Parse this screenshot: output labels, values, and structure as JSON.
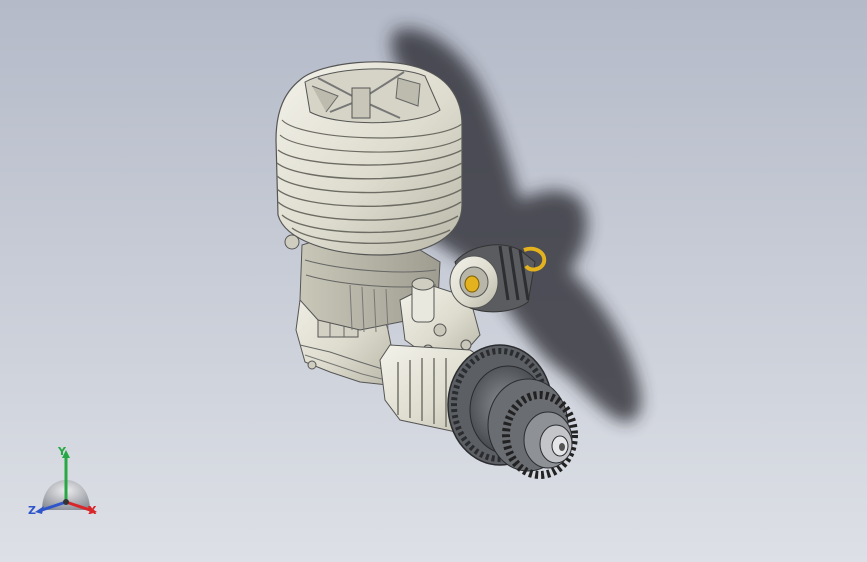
{
  "viewport": {
    "background_top": "#b4bac8",
    "background_bottom": "#dde0e6"
  },
  "model": {
    "subject": "rc-nitro-engine",
    "body_color": "#e4e3d6",
    "shadow_color": "#2a2a30",
    "accent_color": "#e3b21e",
    "dark_part_color": "#4a4d52"
  },
  "triad": {
    "x_label": "X",
    "y_label": "Y",
    "z_label": "Z",
    "x_color": "#d8262a",
    "y_color": "#27a844",
    "z_color": "#2e55c9"
  }
}
